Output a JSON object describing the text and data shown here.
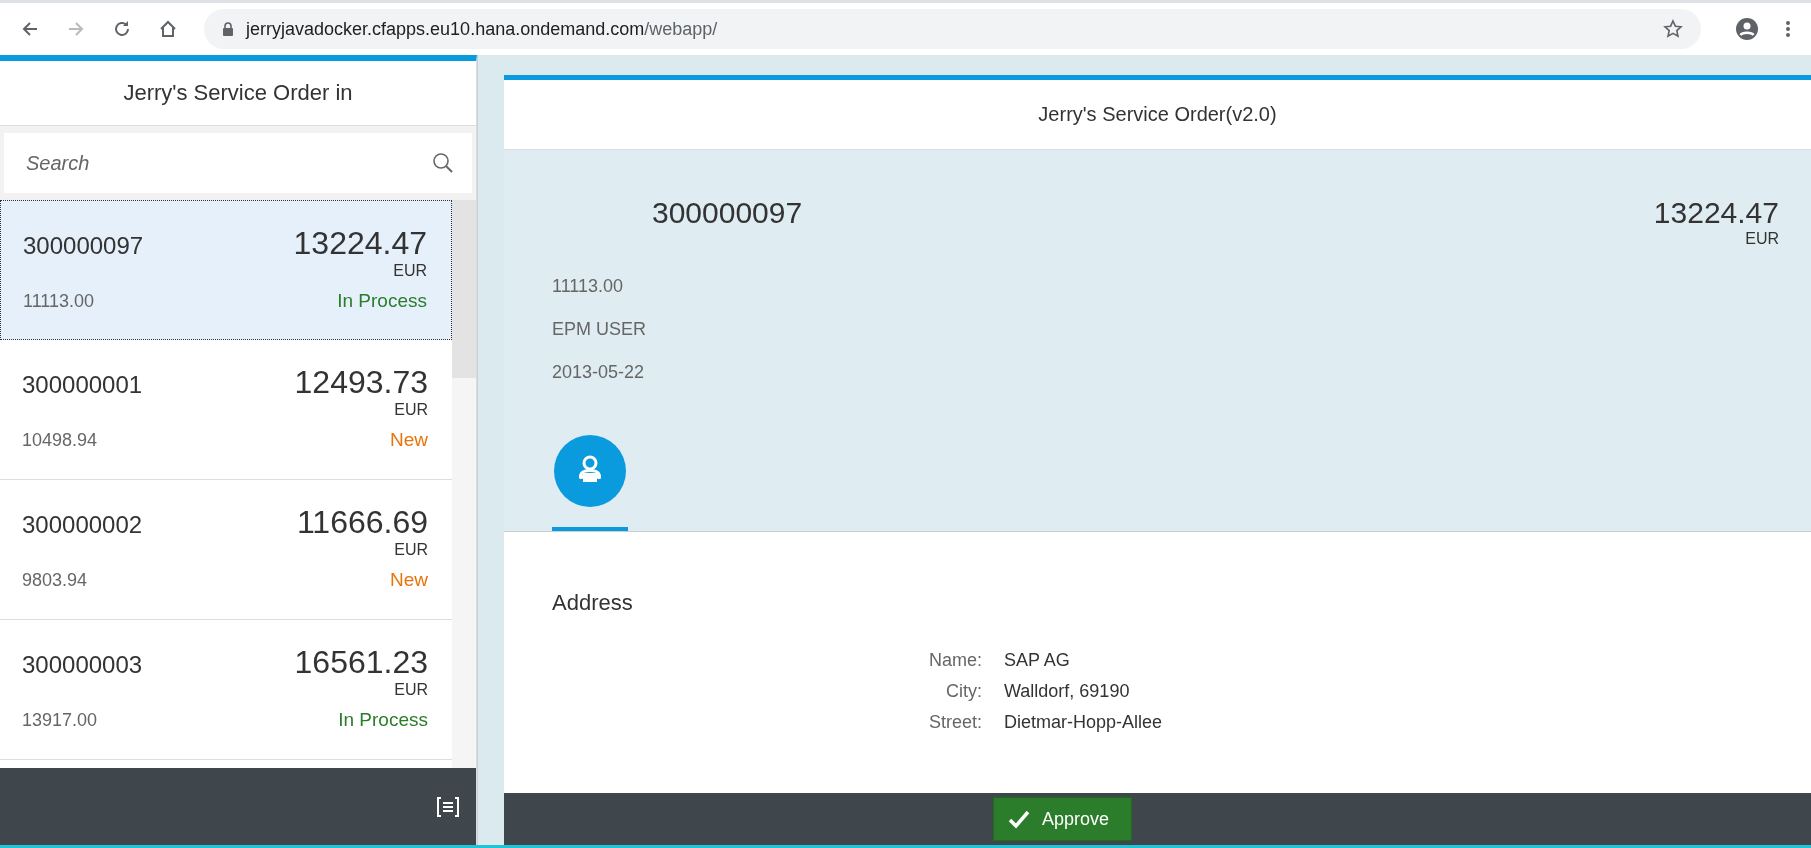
{
  "browser": {
    "url_host": "jerryjavadocker.cfapps.eu10.hana.ondemand.com",
    "url_path": "/webapp/"
  },
  "master": {
    "title": "Jerry's Service Order in",
    "search": {
      "placeholder": "Search"
    },
    "items": [
      {
        "id": "300000097",
        "amount": "13224.47",
        "currency": "EUR",
        "net": "11113.00",
        "status": "In Process",
        "color": "#2b7d2b",
        "selected": true
      },
      {
        "id": "300000001",
        "amount": "12493.73",
        "currency": "EUR",
        "net": "10498.94",
        "status": "New",
        "color": "#e9730c",
        "selected": false
      },
      {
        "id": "300000002",
        "amount": "11666.69",
        "currency": "EUR",
        "net": "9803.94",
        "status": "New",
        "color": "#e9730c",
        "selected": false
      },
      {
        "id": "300000003",
        "amount": "16561.23",
        "currency": "EUR",
        "net": "13917.00",
        "status": "In Process",
        "color": "#2b7d2b",
        "selected": false
      }
    ]
  },
  "detail": {
    "title": "Jerry's Service Order(v2.0)",
    "header": {
      "id": "300000097",
      "amount": "13224.47",
      "currency": "EUR",
      "attributes": [
        "11113.00",
        "EPM USER",
        "2013-05-22"
      ]
    },
    "tabs": [
      {
        "kind": "contact",
        "selected": true
      }
    ],
    "section": {
      "title": "Address",
      "fields": [
        {
          "label": "Name:",
          "value": "SAP AG"
        },
        {
          "label": "City:",
          "value": "Walldorf, 69190"
        },
        {
          "label": "Street:",
          "value": "Dietmar-Hopp-Allee"
        }
      ]
    },
    "footer": {
      "approve": "Approve"
    }
  }
}
